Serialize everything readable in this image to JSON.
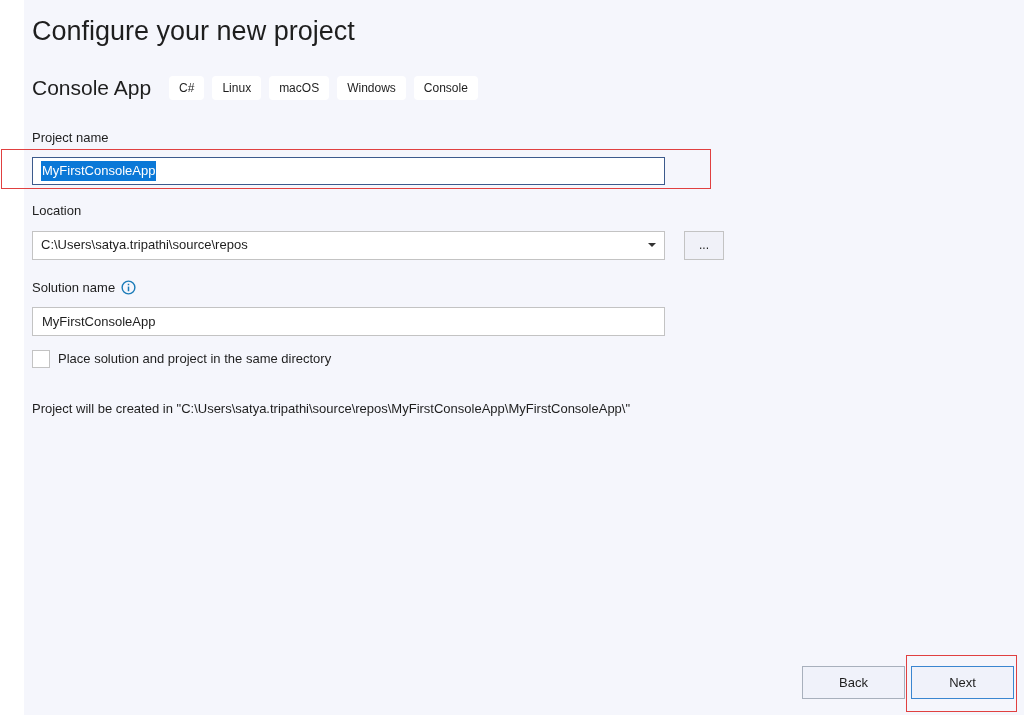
{
  "title": "Configure your new project",
  "template": {
    "name": "Console App",
    "tags": [
      "C#",
      "Linux",
      "macOS",
      "Windows",
      "Console"
    ]
  },
  "project_name": {
    "label": "Project name",
    "value": "MyFirstConsoleApp",
    "selected": true,
    "highlighted": true
  },
  "location": {
    "label": "Location",
    "value": "C:\\Users\\satya.tripathi\\source\\repos",
    "browse": "..."
  },
  "solution_name": {
    "label": "Solution name",
    "value": "MyFirstConsoleApp"
  },
  "same_directory": {
    "label": "Place solution and project in the same directory",
    "checked": false
  },
  "summary": "Project will be created in \"C:\\Users\\satya.tripathi\\source\\repos\\MyFirstConsoleApp\\MyFirstConsoleApp\\\"",
  "buttons": [
    {
      "label": "Back",
      "highlighted": false,
      "focused": false
    },
    {
      "label": "Next",
      "highlighted": true,
      "focused": true
    }
  ]
}
